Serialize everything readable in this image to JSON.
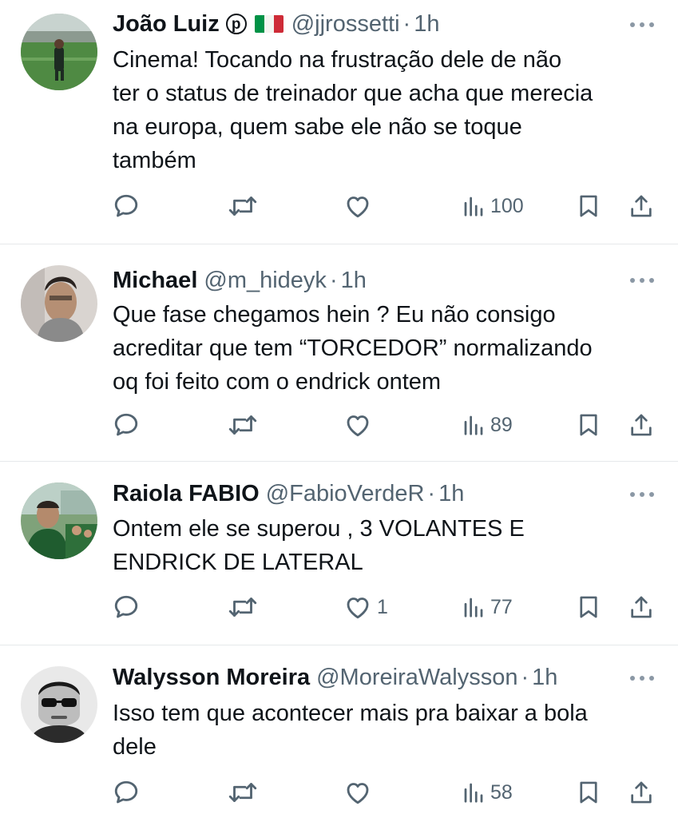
{
  "tweets": [
    {
      "name": "João Luiz",
      "badge": "p",
      "has_flag": true,
      "flag_colors": [
        "#009246",
        "#ffffff",
        "#ce2b37"
      ],
      "handle": "@jjrossetti",
      "separator": "·",
      "time": "1h",
      "text_lines": [
        "Cinema! Tocando na frustração dele de não",
        "ter o status de treinador que acha que merecia",
        "na europa, quem sabe ele não se toque",
        "também"
      ],
      "icons": [
        "reply-icon",
        "retweet-icon",
        "like-icon",
        "views-icon",
        "bookmark-icon",
        "share-icon",
        "more-icon"
      ],
      "reply_count": "",
      "retweet_count": "",
      "like_count": "",
      "views": "100"
    },
    {
      "name": "Michael",
      "handle": "@m_hideyk",
      "separator": "·",
      "time": "1h",
      "text_lines": [
        "Que fase chegamos hein ? Eu não consigo",
        "acreditar que tem “TORCEDOR” normalizando",
        "oq foi feito com o endrick ontem"
      ],
      "reply_count": "",
      "retweet_count": "",
      "like_count": "",
      "views": "89"
    },
    {
      "name": "Raiola FABIO",
      "handle": "@FabioVerdeR",
      "separator": "·",
      "time": "1h",
      "text_lines": [
        "Ontem ele se superou , 3 VOLANTES E",
        "ENDRICK DE LATERAL"
      ],
      "reply_count": "",
      "retweet_count": "",
      "like_count": "1",
      "views": "77"
    },
    {
      "name": "Walysson Moreira",
      "handle": "@MoreiraWalysson",
      "separator": "·",
      "time": "1h",
      "text_lines": [
        "Isso tem que acontecer mais pra baixar a bola",
        "dele"
      ],
      "reply_count": "",
      "retweet_count": "",
      "like_count": "",
      "views": "58"
    }
  ],
  "colors": {
    "text": "#0f1419",
    "muted": "#536471",
    "divider": "#e6e9eb"
  }
}
